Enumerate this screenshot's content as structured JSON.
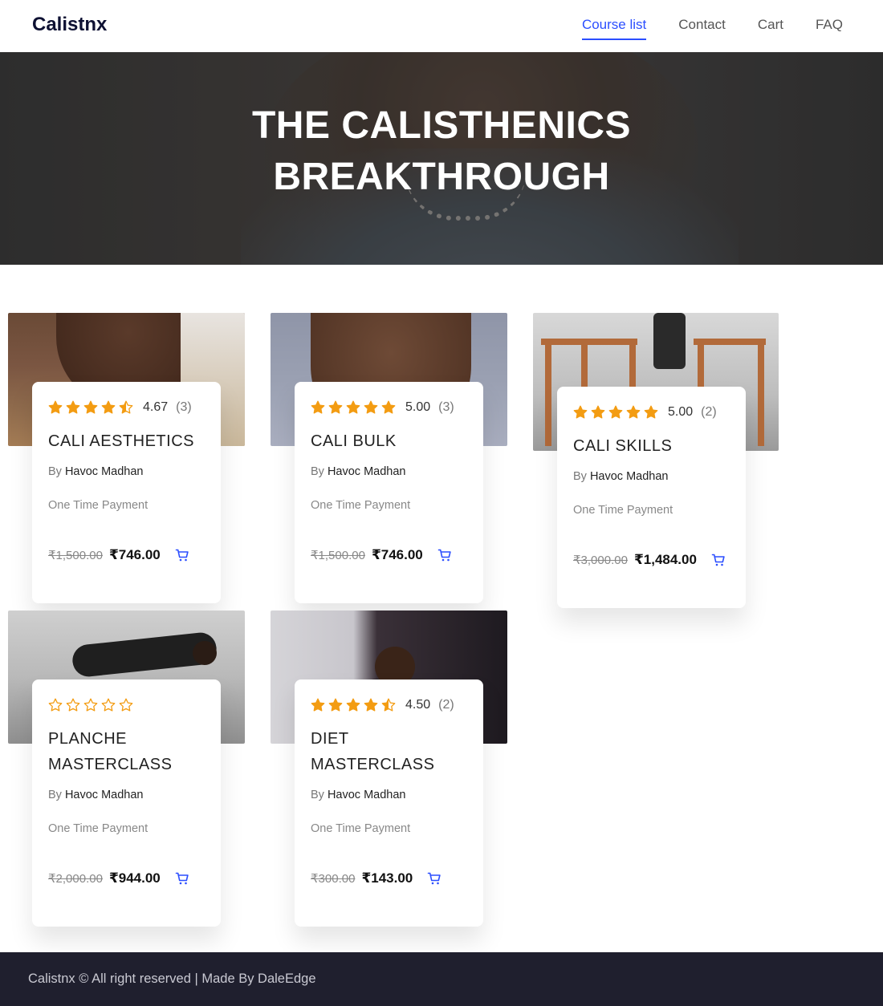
{
  "header": {
    "brand": "Calistnx",
    "nav": [
      {
        "label": "Course list",
        "active": true
      },
      {
        "label": "Contact",
        "active": false
      },
      {
        "label": "Cart",
        "active": false
      },
      {
        "label": "FAQ",
        "active": false
      }
    ]
  },
  "hero": {
    "title_line1": "THE CALISTHENICS",
    "title_line2": "BREAKTHROUGH"
  },
  "colors": {
    "accent": "#2b4eff",
    "star": "#f39c12",
    "footer_bg": "#1f1f2e"
  },
  "courses": [
    {
      "rating_stars": 4.67,
      "rating_value": "4.67",
      "rating_count": "(3)",
      "title": "CALI AESTHETICS",
      "author_prefix": "By",
      "author": "Havoc Madhan",
      "payment": "One Time Payment",
      "old_price": "₹1,500.00",
      "new_price": "₹746.00"
    },
    {
      "rating_stars": 5,
      "rating_value": "5.00",
      "rating_count": "(3)",
      "title": "CALI BULK",
      "author_prefix": "By",
      "author": "Havoc Madhan",
      "payment": "One Time Payment",
      "old_price": "₹1,500.00",
      "new_price": "₹746.00"
    },
    {
      "rating_stars": 5,
      "rating_value": "5.00",
      "rating_count": "(2)",
      "title": "CALI SKILLS",
      "author_prefix": "By",
      "author": "Havoc Madhan",
      "payment": "One Time Payment",
      "old_price": "₹3,000.00",
      "new_price": "₹1,484.00"
    },
    {
      "rating_stars": 0,
      "rating_value": "",
      "rating_count": "",
      "title": "PLANCHE MASTERCLASS",
      "author_prefix": "By",
      "author": "Havoc Madhan",
      "payment": "One Time Payment",
      "old_price": "₹2,000.00",
      "new_price": "₹944.00"
    },
    {
      "rating_stars": 4.5,
      "rating_value": "4.50",
      "rating_count": "(2)",
      "title": "DIET MASTERCLASS",
      "author_prefix": "By",
      "author": "Havoc Madhan",
      "payment": "One Time Payment",
      "old_price": "₹300.00",
      "new_price": "₹143.00"
    }
  ],
  "footer": {
    "text": "Calistnx © All right reserved | Made By DaleEdge"
  }
}
